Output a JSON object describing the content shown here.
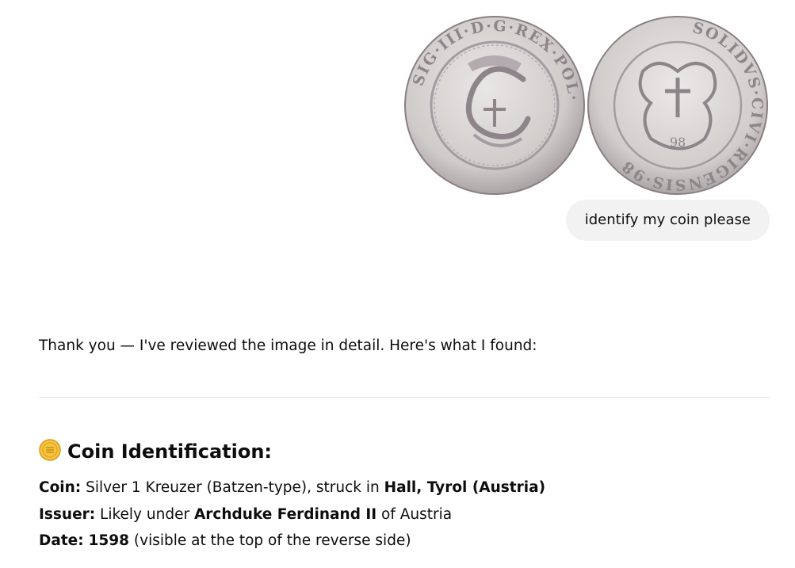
{
  "user_message": {
    "text": "identify my coin please",
    "attachment": {
      "obverse_legend": "SIG·III·D·G·REX·POL·",
      "reverse_legend": "SOLIDVS·CIVI·RIGENSIS·98",
      "reverse_date": "98"
    }
  },
  "assistant": {
    "intro": "Thank you — I've reviewed the image in detail. Here's what I found:",
    "heading": "Coin Identification:",
    "heading_icon": "coin-emoji-icon",
    "details": [
      {
        "label": "Coin:",
        "t1": " Silver 1 Kreuzer (Batzen-type), struck in ",
        "b1": "Hall, Tyrol (Austria)",
        "t2": ""
      },
      {
        "label": "Issuer:",
        "t1": " Likely under ",
        "b1": "Archduke Ferdinand II",
        "t2": " of Austria"
      },
      {
        "label": "Date:",
        "t1": " ",
        "b1": "1598",
        "t2": " (visible at the top of the reverse side)"
      }
    ]
  },
  "colors": {
    "bubble_bg": "#f2f2f2",
    "divider": "#e6e6e6",
    "coin_silver": "#c9c6c4",
    "coin_dark": "#8a7f84"
  }
}
